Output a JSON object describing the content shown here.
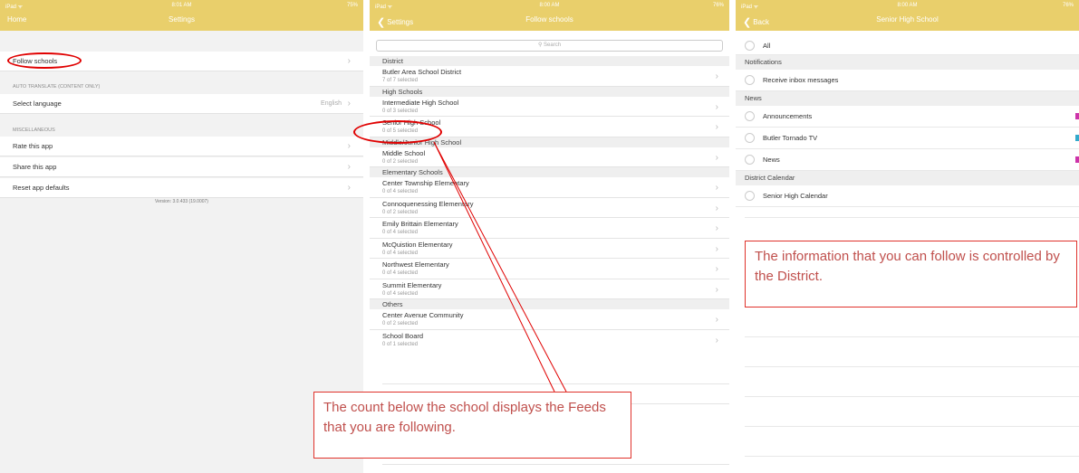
{
  "colors": {
    "navbar": "#e9cf6b",
    "annotation": "#e0322b",
    "news_badge_magenta": "#cc33aa",
    "news_badge_teal": "#33aacc"
  },
  "settings": {
    "status": {
      "device": "iPad ᯤ",
      "time": "8:01 AM",
      "battery": "75%"
    },
    "nav_left": "Home",
    "title": "Settings",
    "follow_schools": "Follow schools",
    "auto_translate_header": "AUTO TRANSLATE (CONTENT ONLY)",
    "select_language": "Select language",
    "language_value": "English",
    "misc_header": "MISCELLANEOUS",
    "rate_app": "Rate this app",
    "share_app": "Share this app",
    "reset_defaults": "Reset app defaults",
    "version": "Version: 3.0.433 (19.0007)"
  },
  "follow": {
    "status": {
      "device": "iPad ᯤ",
      "time": "8:00 AM",
      "battery": "76%"
    },
    "back_label": "Settings",
    "title": "Follow schools",
    "search_placeholder": "Search",
    "sections": [
      {
        "header": "District",
        "items": [
          {
            "name": "Butler Area School District",
            "count": "7 of 7 selected"
          }
        ]
      },
      {
        "header": "High Schools",
        "items": [
          {
            "name": "Intermediate High School",
            "count": "0 of 3 selected"
          },
          {
            "name": "Senior High School",
            "count": "0 of 5 selected"
          }
        ]
      },
      {
        "header": "Middle/Junior High School",
        "items": [
          {
            "name": "Middle School",
            "count": "0 of 2 selected"
          }
        ]
      },
      {
        "header": "Elementary Schools",
        "items": [
          {
            "name": "Center Township Elementary",
            "count": "0 of 4 selected"
          },
          {
            "name": "Connoquenessing Elementary",
            "count": "0 of 2 selected"
          },
          {
            "name": "Emily Brittain Elementary",
            "count": "0 of 4 selected"
          },
          {
            "name": "McQuistion Elementary",
            "count": "0 of 4 selected"
          },
          {
            "name": "Northwest Elementary",
            "count": "0 of 4 selected"
          },
          {
            "name": "Summit Elementary",
            "count": "0 of 4 selected"
          }
        ]
      },
      {
        "header": "Others",
        "items": [
          {
            "name": "Center Avenue Community",
            "count": "0 of 2 selected"
          },
          {
            "name": "School Board",
            "count": "0 of 1 selected"
          }
        ]
      }
    ]
  },
  "senior": {
    "status": {
      "device": "iPad ᯤ",
      "time": "8:00 AM",
      "battery": "76%"
    },
    "back_label": "Back",
    "title": "Senior High School",
    "all_label": "All",
    "notifications_header": "Notifications",
    "receive_inbox": "Receive inbox messages",
    "news_header": "News",
    "announcements": "Announcements",
    "butler_tv": "Butler Tornado TV",
    "news": "News",
    "calendar_header": "District Calendar",
    "senior_calendar": "Senior High Calendar"
  },
  "annotations": {
    "count_note": "The count below the school displays the Feeds that you are following.",
    "district_note": "The information that you can follow is controlled by the District."
  }
}
